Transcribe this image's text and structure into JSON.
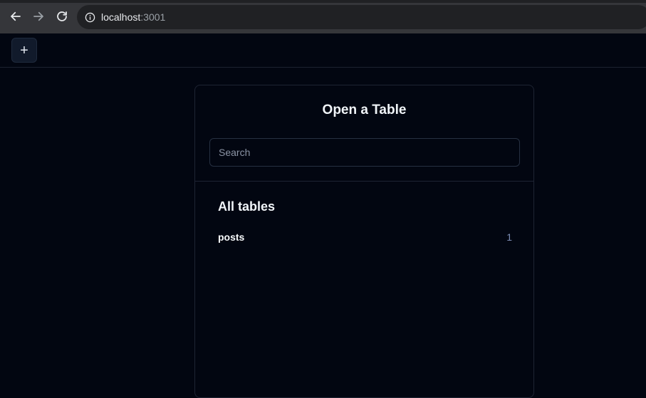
{
  "browser": {
    "url_host": "localhost",
    "url_port": ":3001"
  },
  "toolbar": {
    "add_label": "+"
  },
  "dialog": {
    "title": "Open a Table",
    "search_placeholder": "Search",
    "section_title": "All tables",
    "tables": [
      {
        "name": "posts",
        "count": "1"
      }
    ]
  },
  "colors": {
    "background": "#020611",
    "panel_border": "#1e2433",
    "count_text": "#7c8db5"
  }
}
